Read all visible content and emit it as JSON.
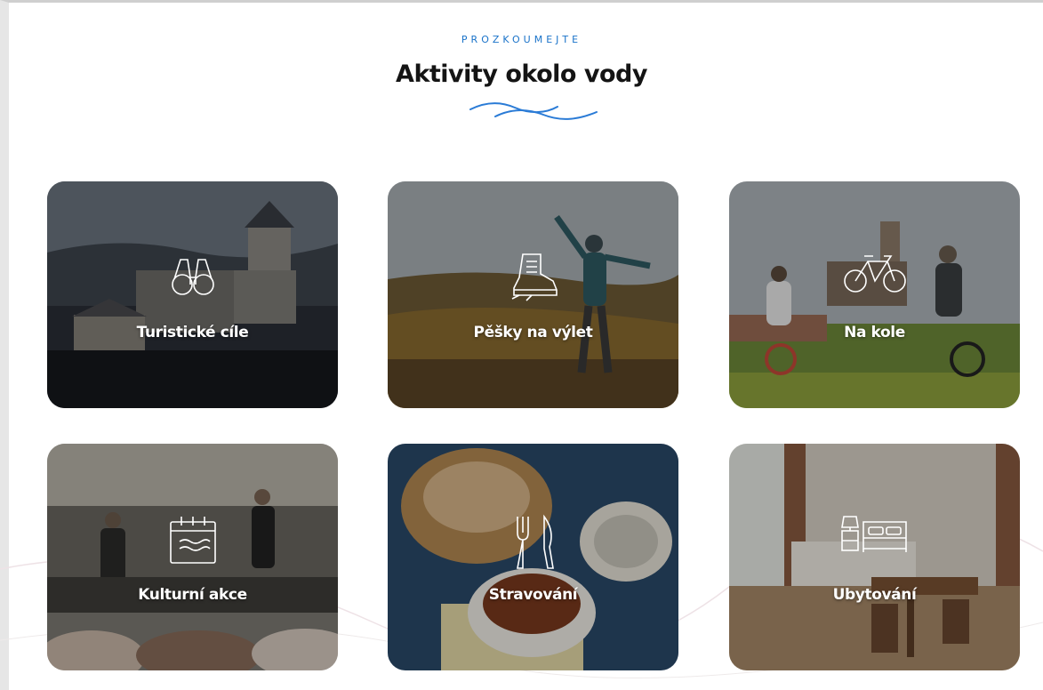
{
  "section": {
    "eyebrow": "PROZKOUMEJTE",
    "title": "Aktivity okolo vody"
  },
  "colors": {
    "accent": "#1a73c9",
    "title": "#141414"
  },
  "cards": [
    {
      "label": "Turistické cíle",
      "icon": "binoculars-icon"
    },
    {
      "label": "Pěšky na výlet",
      "icon": "hiking-boot-icon"
    },
    {
      "label": "Na kole",
      "icon": "bicycle-icon"
    },
    {
      "label": "Kulturní akce",
      "icon": "calendar-icon"
    },
    {
      "label": "Stravování",
      "icon": "fork-knife-icon"
    },
    {
      "label": "Ubytování",
      "icon": "bed-nightstand-icon"
    }
  ]
}
